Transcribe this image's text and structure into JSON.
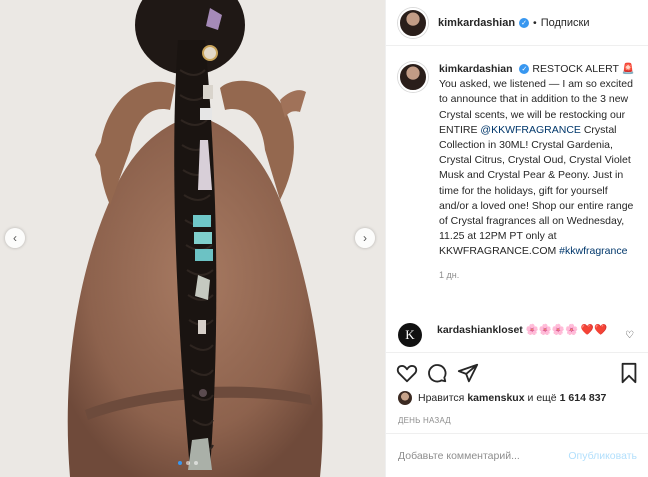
{
  "post": {
    "username": "kimkardashian",
    "follow_label": "Подписки",
    "caption": {
      "username": "kimkardashian",
      "lead": "RESTOCK ALERT",
      "emoji": "🚨",
      "body_1": "You asked, we listened — I am so excited to announce that in addition to the 3 new Crystal scents, we will be restocking our ENTIRE ",
      "mention": "@KKWFRAGRANCE",
      "body_2": " Crystal Collection in 30ML! Crystal Gardenia, Crystal Citrus, Crystal Oud, Crystal Violet Musk and Crystal Pear & Peony. Just in time for the holidays, gift for yourself and/or a loved one! Shop our entire range of Crystal fragrances all on Wednesday, 11.25 at 12PM PT only at KKWFRAGRANCE.COM ",
      "hashtag": "#kkwfragrance",
      "time": "1 дн."
    },
    "comment": {
      "username": "kardashiankloset",
      "text": "🌸🌸🌸🌸 ❤️❤️",
      "avatar_letter": "K"
    },
    "likes": {
      "prefix": "Нравится ",
      "user": "kamenskux",
      "middle": " и ещё ",
      "count": "1 614 837"
    },
    "day_ago": "ДЕНЬ НАЗАД",
    "comment_input": {
      "placeholder": "Добавьте комментарий...",
      "publish_label": "Опубликовать"
    },
    "carousel": {
      "slide_count": 3,
      "active_index": 0
    }
  },
  "icons": {
    "like": "heart-icon",
    "comment": "comment-icon",
    "share": "paper-plane-icon",
    "save": "bookmark-icon",
    "verified": "verified-badge-icon",
    "prev": "chevron-left-icon",
    "next": "chevron-right-icon"
  },
  "colors": {
    "link": "#00376b",
    "verified": "#3897f0",
    "publish_disabled": "#b2dffc"
  }
}
